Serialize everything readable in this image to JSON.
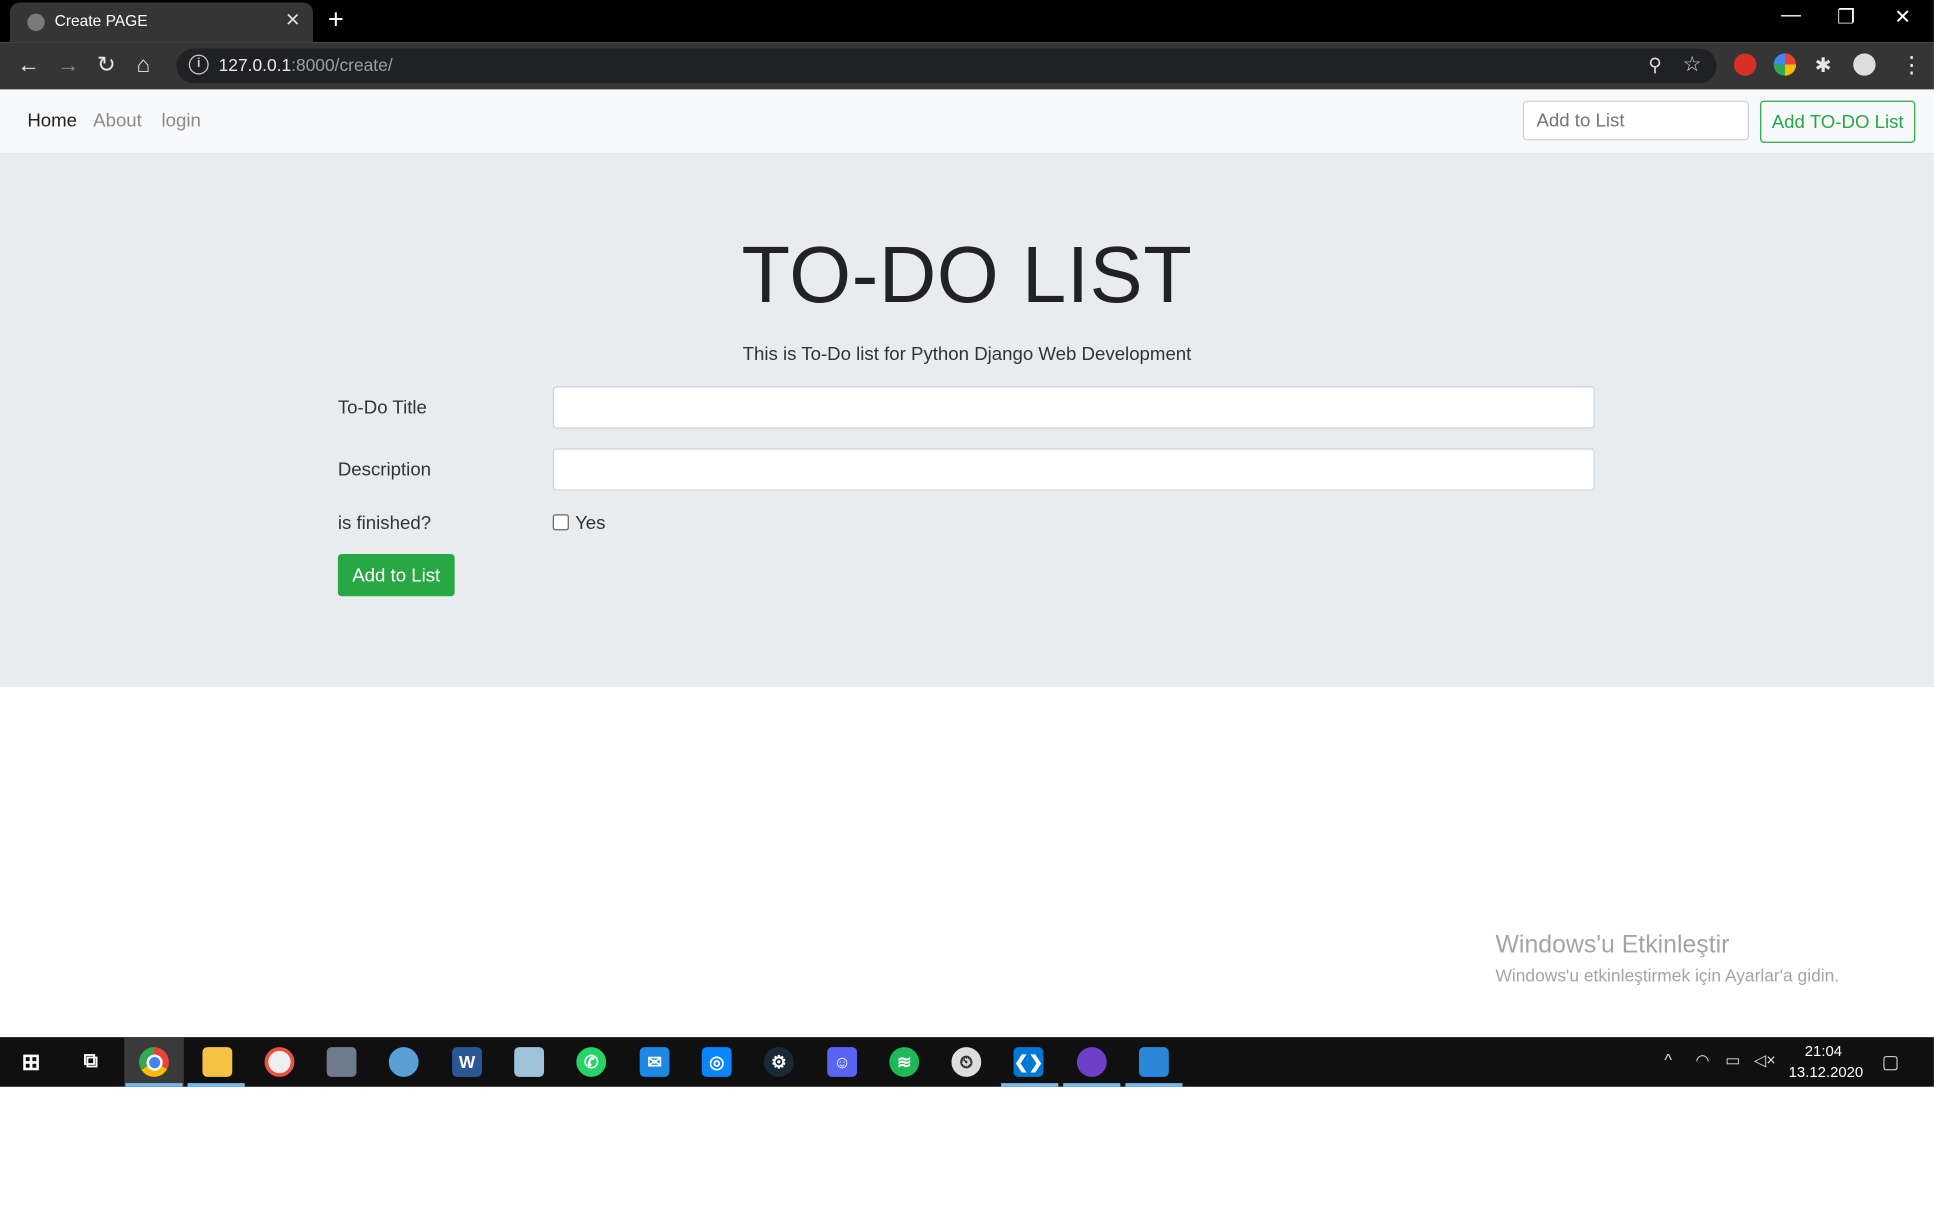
{
  "browser": {
    "tab_title": "Create PAGE",
    "url_host": "127.0.0.1",
    "url_rest": ":8000/create/"
  },
  "nav": {
    "links": [
      "Home",
      "About",
      "login"
    ],
    "search_placeholder": "Add to List",
    "add_button": "Add TO-DO List"
  },
  "jumbotron": {
    "title": "TO-DO LIST",
    "lead": "This is To-Do list for Python Django Web Development"
  },
  "form": {
    "title_label": "To-Do Title",
    "description_label": "Description",
    "finished_label": "is finished?",
    "checkbox_label": "Yes",
    "submit_label": "Add to List"
  },
  "watermark": {
    "line1": "Windows'u Etkinleştir",
    "line2": "Windows'u etkinleştirmek için Ayarlar'a gidin."
  },
  "taskbar": {
    "time": "21:04",
    "date": "13.12.2020"
  },
  "colors": {
    "success": "#28a745",
    "jumbotron_bg": "#e9ecef",
    "navbar_bg": "#f8f9fa"
  }
}
